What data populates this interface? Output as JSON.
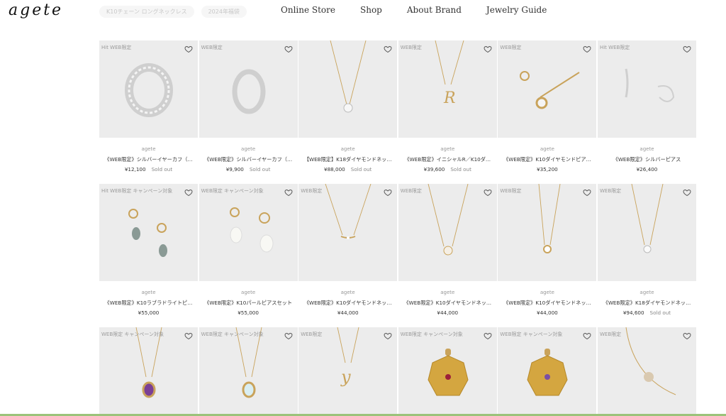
{
  "header": {
    "logo": "agete",
    "chips": [
      "K10チェーン ロングネックレス",
      "2024年福袋"
    ],
    "nav": [
      "Online Store",
      "Shop",
      "About Brand",
      "Jewelry Guide"
    ]
  },
  "products": [
    {
      "tag": "Hit  WEB限定",
      "brand": "agete",
      "title": "《WEB限定》シルバーイヤーカフ（…",
      "price": "¥12,100",
      "sold": "Sold out",
      "icon": "ear-cuff-wide"
    },
    {
      "tag": "WEB限定",
      "brand": "agete",
      "title": "《WEB限定》シルバーイヤーカフ（…",
      "price": "¥9,900",
      "sold": "Sold out",
      "icon": "ear-cuff-slim"
    },
    {
      "tag": "",
      "brand": "agete",
      "title": "【WEB限定】K18ダイヤモンドネッ…",
      "price": "¥88,000",
      "sold": "Sold out",
      "icon": "diamond-necklace"
    },
    {
      "tag": "WEB限定",
      "brand": "agete",
      "title": "《WEB限定》イニシャルR／K10ダ…",
      "price": "¥39,600",
      "sold": "Sold out",
      "icon": "initial-necklace"
    },
    {
      "tag": "WEB限定",
      "brand": "agete",
      "title": "《WEB限定》K10ダイヤモンドピア…",
      "price": "¥35,200",
      "sold": "",
      "icon": "stud-earrings"
    },
    {
      "tag": "Hit  WEB限定",
      "brand": "agete",
      "title": "《WEB限定》シルバーピアス",
      "price": "¥26,400",
      "sold": "",
      "icon": "silver-hoop"
    },
    {
      "tag": "Hit  WEB限定  キャンペーン対象",
      "brand": "agete",
      "title": "《WEB限定》K10ラブラドライトピ…",
      "price": "¥55,000",
      "sold": "",
      "icon": "labradorite-earrings"
    },
    {
      "tag": "WEB限定  キャンペーン対象",
      "brand": "agete",
      "title": "《WEB限定》K10パールピアスセット",
      "price": "¥55,000",
      "sold": "",
      "icon": "pearl-earrings"
    },
    {
      "tag": "WEB限定",
      "brand": "agete",
      "title": "《WEB限定》K10ダイヤモンドネッ…",
      "price": "¥44,000",
      "sold": "",
      "icon": "bar-necklace"
    },
    {
      "tag": "WEB限定",
      "brand": "agete",
      "title": "《WEB限定》K10ダイヤモンドネッ…",
      "price": "¥44,000",
      "sold": "",
      "icon": "diamond-pendant"
    },
    {
      "tag": "WEB限定",
      "brand": "agete",
      "title": "《WEB限定》K10ダイヤモンドネッ…",
      "price": "¥44,000",
      "sold": "",
      "icon": "bezel-necklace"
    },
    {
      "tag": "WEB限定",
      "brand": "agete",
      "title": "《WEB限定》K18ダイヤモンドネッ…",
      "price": "¥94,600",
      "sold": "Sold out",
      "icon": "solitaire-necklace"
    },
    {
      "tag": "WEB限定  キャンペーン対象",
      "icon": "amethyst-necklace"
    },
    {
      "tag": "WEB限定  キャンペーン対象",
      "icon": "blue-topaz-necklace"
    },
    {
      "tag": "WEB限定",
      "icon": "initial-y-necklace"
    },
    {
      "tag": "WEB限定  キャンペーン対象",
      "icon": "coin-pendant-ruby"
    },
    {
      "tag": "WEB限定  キャンペーン対象",
      "icon": "coin-pendant-amethyst"
    },
    {
      "tag": "WEB限定",
      "icon": "disc-bracelet"
    }
  ],
  "colors": {
    "gold": "#c9a35b",
    "silver": "#cfcfcf",
    "accent_line": "#9bc37a"
  }
}
